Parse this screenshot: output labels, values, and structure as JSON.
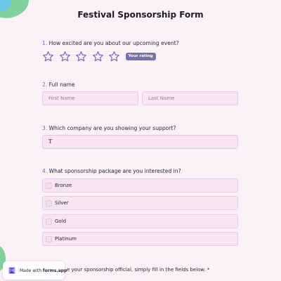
{
  "form": {
    "title": "Festival Sponsorship Form"
  },
  "questions": [
    {
      "number": "1.",
      "text": "How excited are you about our upcoming event?"
    },
    {
      "number": "2.",
      "text": "Full name"
    },
    {
      "number": "3.",
      "text": "Which company are you showing your support?"
    },
    {
      "number": "4.",
      "text": "What sponsorship package are you interested in?"
    }
  ],
  "rating": {
    "stars": 5,
    "selected": 0,
    "badge": "Your rating",
    "star_color": "#7a6fb0"
  },
  "name_fields": {
    "first_placeholder": "First Name",
    "last_placeholder": "Last Name"
  },
  "company_field": {
    "value": "T"
  },
  "packages": [
    "Bronze",
    "Silver",
    "Gold",
    "Platinum"
  ],
  "footer": {
    "text": "e your sponsorship official, simply fill in the fields below. *"
  },
  "badge": {
    "prefix": "Made with",
    "brand": "forms.app"
  },
  "colors": {
    "background": "#fdf1f8",
    "field_bg": "#f9e4f6",
    "field_border": "#e7c9ea",
    "accent": "#7a6fb0"
  }
}
